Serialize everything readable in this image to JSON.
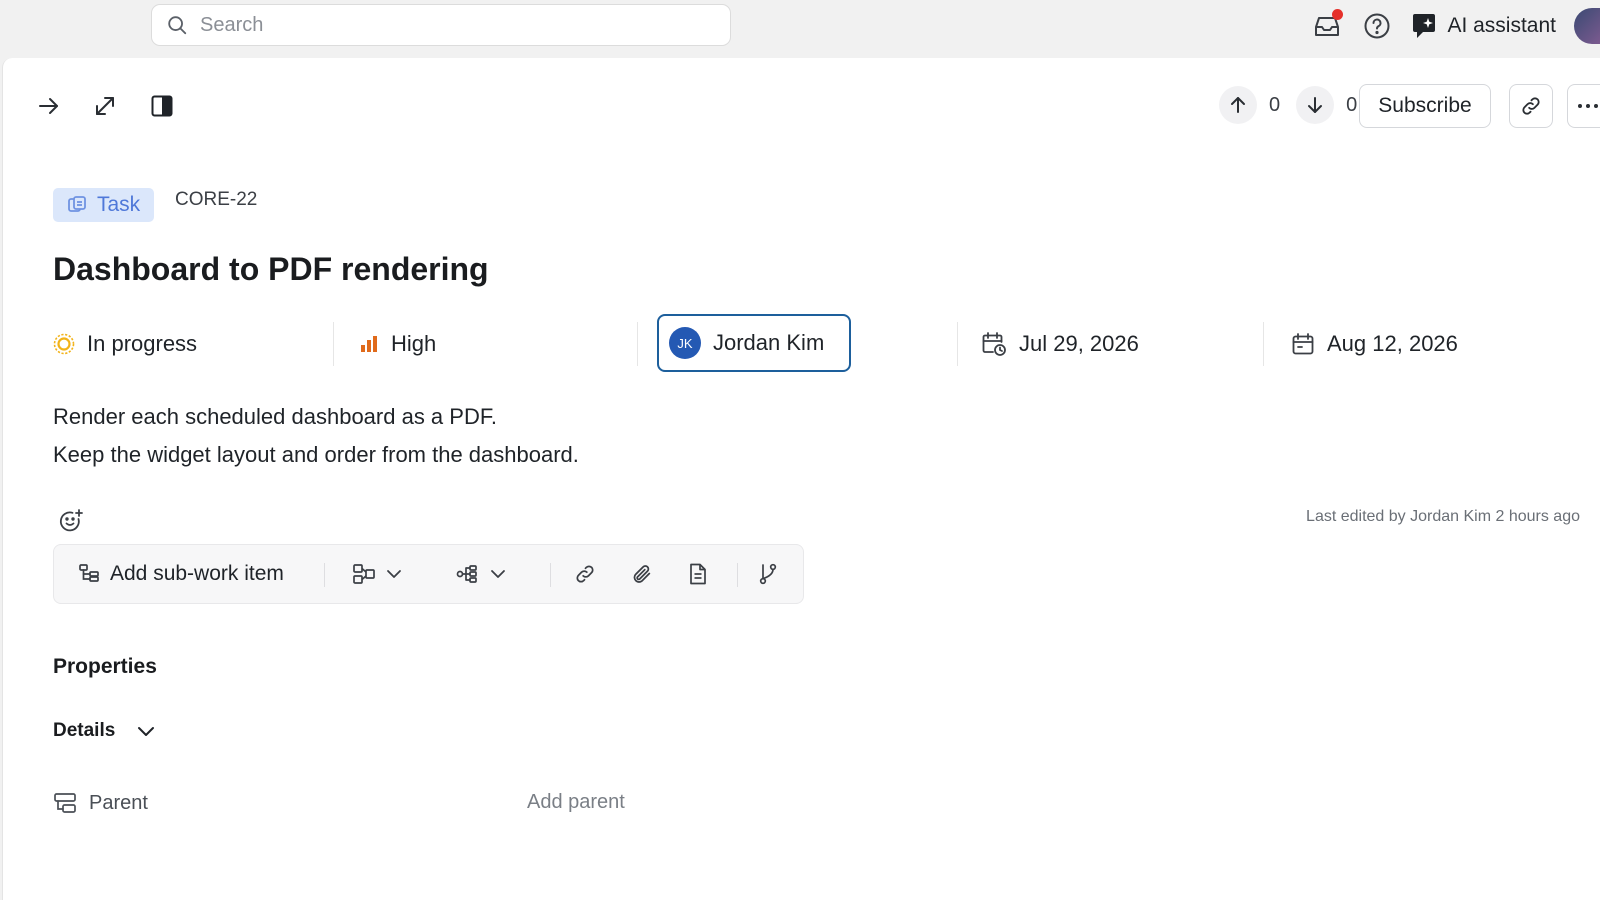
{
  "topbar": {
    "search_placeholder": "Search",
    "ai_label": "AI assistant"
  },
  "toolbar": {
    "upvotes": "0",
    "downvotes": "0",
    "subscribe_label": "Subscribe"
  },
  "work_item": {
    "type": "Task",
    "id": "CORE-22",
    "title": "Dashboard to PDF rendering",
    "state": "In progress",
    "priority": "High",
    "assignee": {
      "initials": "JK",
      "name": "Jordan Kim"
    },
    "start_date": "Jul 29, 2026",
    "due_date": "Aug 12, 2026",
    "description": [
      "Render each scheduled dashboard as a PDF.",
      "Keep the widget layout and order from the dashboard."
    ],
    "last_edited": "Last edited by Jordan Kim 2 hours ago"
  },
  "actions": {
    "add_sub_item": "Add sub-work item"
  },
  "properties": {
    "heading": "Properties",
    "details_label": "Details",
    "parent_label": "Parent",
    "parent_value": "Add parent"
  },
  "colors": {
    "accent": "#1d5f9c",
    "badge_bg": "#dbe7fb",
    "badge_text": "#4f78d9",
    "priority_high": "#e06a1b",
    "in_progress": "#f2b31a",
    "notification": "#e5302a"
  }
}
